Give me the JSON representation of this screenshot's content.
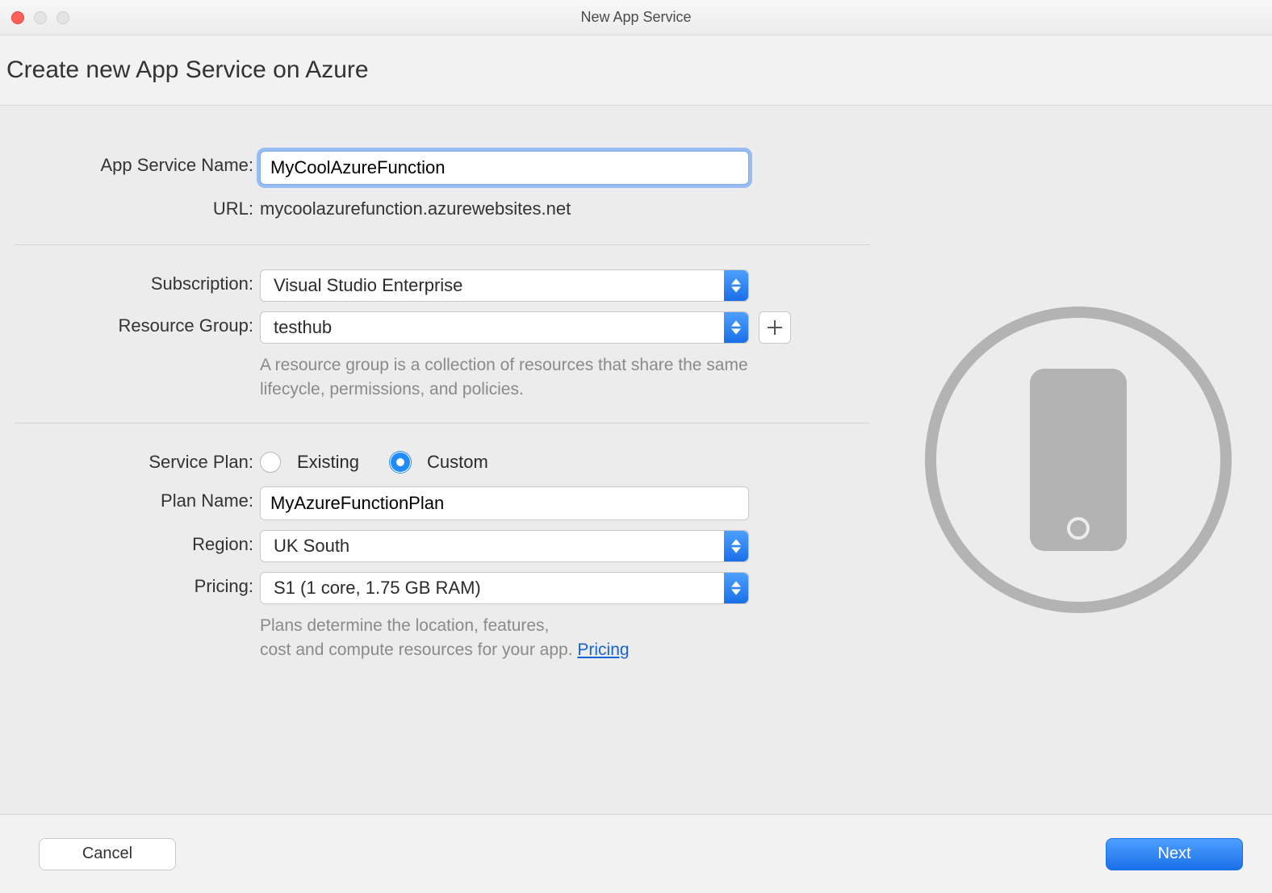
{
  "window": {
    "title": "New App Service"
  },
  "header": {
    "title": "Create new App Service on Azure"
  },
  "labels": {
    "app_service_name": "App Service Name:",
    "url": "URL:",
    "subscription": "Subscription:",
    "resource_group": "Resource Group:",
    "service_plan": "Service Plan:",
    "plan_name": "Plan Name:",
    "region": "Region:",
    "pricing": "Pricing:"
  },
  "values": {
    "app_service_name": "MyCoolAzureFunction",
    "url": "mycoolazurefunction.azurewebsites.net",
    "subscription": "Visual Studio Enterprise",
    "resource_group": "testhub",
    "plan_name": "MyAzureFunctionPlan",
    "region": "UK South",
    "pricing": "S1 (1 core, 1.75 GB RAM)"
  },
  "service_plan_radio": {
    "existing": "Existing",
    "custom": "Custom",
    "selected": "custom"
  },
  "helpers": {
    "resource_group": "A resource group is a collection of resources that share the same lifecycle, permissions, and policies.",
    "pricing_line1": "Plans determine the location, features,",
    "pricing_line2": "cost and compute resources for your app.  ",
    "pricing_link": "Pricing"
  },
  "buttons": {
    "cancel": "Cancel",
    "next": "Next",
    "add": "+"
  }
}
